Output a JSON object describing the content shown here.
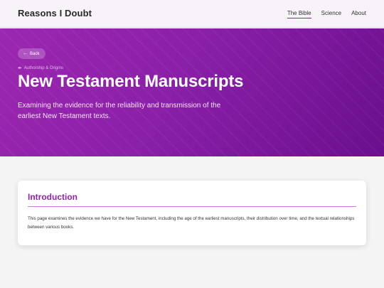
{
  "header": {
    "site_title": "Reasons I Doubt",
    "nav": [
      {
        "label": "The Bible",
        "active": true
      },
      {
        "label": "Science",
        "active": false
      },
      {
        "label": "About",
        "active": false
      }
    ]
  },
  "hero": {
    "back_label": "Back",
    "back_icon": "arrow-left-icon",
    "category_icon": "quill-icon",
    "category": "Authorship & Origins",
    "title": "New Testament Manuscripts",
    "subtitle": "Examining the evidence for the reliability and transmission of the earliest New Testament texts.",
    "gradient_start": "#9c27b0",
    "gradient_end": "#6a0f8c"
  },
  "intro": {
    "heading": "Introduction",
    "body": "This page examines the evidence we have for the New Testament, including the age of the earliest manuscripts, their distribution over time, and the textual relationships between various books."
  },
  "colors": {
    "accent": "#8e24aa",
    "page_bg": "#f4f4f4",
    "header_bg": "#f7f3f8"
  }
}
